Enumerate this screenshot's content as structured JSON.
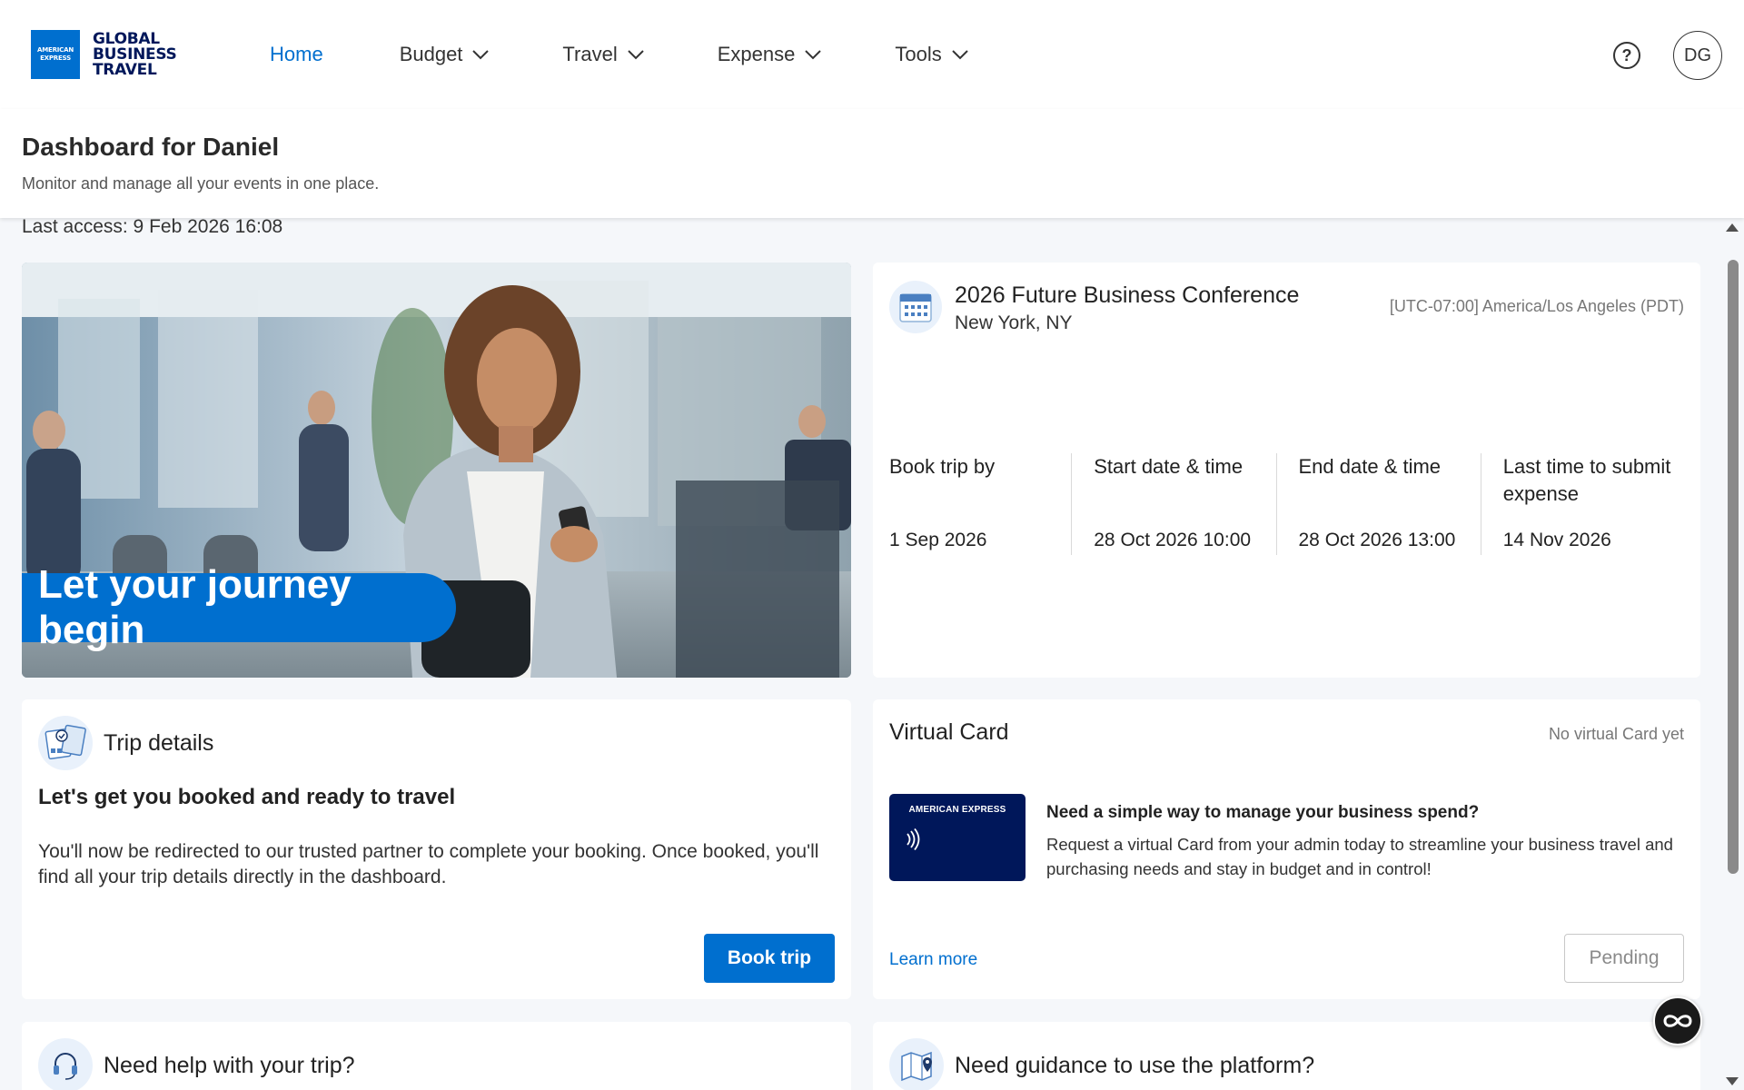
{
  "brand": {
    "logo_box_lines": [
      "AMERICAN",
      "EXPRESS"
    ],
    "logo_text_lines": [
      "GLOBAL",
      "BUSINESS",
      "TRAVEL"
    ],
    "accent": "#006fcf",
    "navy": "#00175a"
  },
  "nav": {
    "items": [
      {
        "label": "Home",
        "active": true
      },
      {
        "label": "Budget",
        "icon": "chevron-down-icon"
      },
      {
        "label": "Travel",
        "icon": "chevron-down-icon"
      },
      {
        "label": "Expense",
        "icon": "chevron-down-icon"
      },
      {
        "label": "Tools",
        "icon": "chevron-down-icon"
      }
    ],
    "help_icon": "?",
    "avatar_initials": "DG"
  },
  "page": {
    "title": "Dashboard for Daniel",
    "subtitle": "Monitor and manage all your events in one place.",
    "last_access": "Last access: 9 Feb 2026 16:08"
  },
  "hero": {
    "banner": "Let your journey begin"
  },
  "event": {
    "icon": "calendar-icon",
    "title": "2026 Future Business Conference",
    "location": "New York, NY",
    "timezone": "[UTC-07:00] America/Los Angeles (PDT)",
    "dates": [
      {
        "label": "Book trip by",
        "value": "1 Sep 2026"
      },
      {
        "label": "Start date & time",
        "value": "28 Oct 2026 10:00"
      },
      {
        "label": "End date & time",
        "value": "28 Oct 2026 13:00"
      },
      {
        "label": "Last time to submit expense",
        "value": "14 Nov 2026"
      }
    ]
  },
  "trip": {
    "icon": "trip-documents-icon",
    "title": "Trip details",
    "heading": "Let's get you booked and ready to travel",
    "body": "You'll now be redirected to our trusted partner to complete your booking. Once booked, you'll find all your trip details directly in the dashboard.",
    "button": "Book trip"
  },
  "virtual_card": {
    "title": "Virtual Card",
    "status": "No virtual Card yet",
    "card_brand": "AMERICAN EXPRESS",
    "question": "Need a simple way to manage your business spend?",
    "description": "Request a virtual Card from your admin today to streamline your business travel and purchasing needs and stay in budget and in control!",
    "learn_more": "Learn more",
    "button": "Pending"
  },
  "help": {
    "icon": "headset-icon",
    "title": "Need help with your trip?"
  },
  "guide": {
    "icon": "map-pin-icon",
    "title": "Need guidance to use the platform?"
  }
}
